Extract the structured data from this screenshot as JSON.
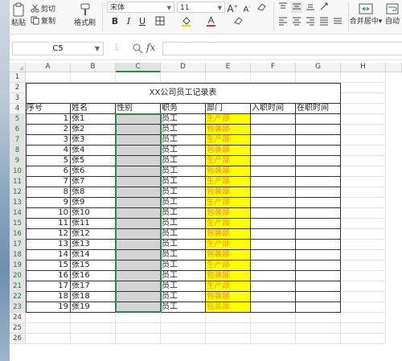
{
  "ribbon": {
    "paste_label": "粘贴",
    "cut_label": "剪切",
    "copy_label": "复制",
    "format_painter_label": "格式刷",
    "font_name": "宋体",
    "font_size": "11",
    "bold": "B",
    "italic": "I",
    "underline": "U",
    "grow_font": "A",
    "shrink_font": "A",
    "merge_center_label": "合并居中",
    "wrap_label": "自动"
  },
  "formula_bar": {
    "name_box": "C5",
    "fx": "fx",
    "formula": ""
  },
  "columns": [
    "A",
    "B",
    "C",
    "D",
    "E",
    "F",
    "G",
    "H"
  ],
  "selected_column": "C",
  "rows": [
    "1",
    "2",
    "3",
    "4",
    "5",
    "6",
    "7",
    "8",
    "9",
    "10",
    "11",
    "12",
    "13",
    "14",
    "15",
    "16",
    "17",
    "18",
    "19",
    "20",
    "21",
    "22",
    "23",
    "24",
    "25",
    "26"
  ],
  "selected_rows": [
    "5",
    "6",
    "7",
    "8",
    "9",
    "10",
    "11",
    "12",
    "13",
    "14",
    "15",
    "16",
    "17",
    "18",
    "19",
    "20",
    "21",
    "22",
    "23"
  ],
  "sheet": {
    "title": "XX公司员工记录表",
    "headers": [
      "序号",
      "姓名",
      "性别",
      "职务",
      "部门",
      "入职时间",
      "在职时间"
    ],
    "records": [
      {
        "no": "1",
        "name": "张1",
        "gender": "",
        "role": "员工",
        "dept": "生产部"
      },
      {
        "no": "2",
        "name": "张2",
        "gender": "",
        "role": "员工",
        "dept": "包装部"
      },
      {
        "no": "3",
        "name": "张3",
        "gender": "",
        "role": "员工",
        "dept": "生产部"
      },
      {
        "no": "4",
        "name": "张4",
        "gender": "",
        "role": "员工",
        "dept": "包装部"
      },
      {
        "no": "5",
        "name": "张5",
        "gender": "",
        "role": "员工",
        "dept": "生产部"
      },
      {
        "no": "6",
        "name": "张6",
        "gender": "",
        "role": "员工",
        "dept": "包装部"
      },
      {
        "no": "7",
        "name": "张7",
        "gender": "",
        "role": "员工",
        "dept": "生产部"
      },
      {
        "no": "8",
        "name": "张8",
        "gender": "",
        "role": "员工",
        "dept": "包装部"
      },
      {
        "no": "9",
        "name": "张9",
        "gender": "",
        "role": "员工",
        "dept": "生产部"
      },
      {
        "no": "10",
        "name": "张10",
        "gender": "",
        "role": "员工",
        "dept": "包装部"
      },
      {
        "no": "11",
        "name": "张11",
        "gender": "",
        "role": "员工",
        "dept": "生产部"
      },
      {
        "no": "12",
        "name": "张12",
        "gender": "",
        "role": "员工",
        "dept": "包装部"
      },
      {
        "no": "13",
        "name": "张13",
        "gender": "",
        "role": "员工",
        "dept": "生产部"
      },
      {
        "no": "14",
        "name": "张14",
        "gender": "",
        "role": "员工",
        "dept": "包装部"
      },
      {
        "no": "15",
        "name": "张15",
        "gender": "",
        "role": "员工",
        "dept": "生产部"
      },
      {
        "no": "16",
        "name": "张16",
        "gender": "",
        "role": "员工",
        "dept": "包装部"
      },
      {
        "no": "17",
        "name": "张17",
        "gender": "",
        "role": "员工",
        "dept": "生产部"
      },
      {
        "no": "18",
        "name": "张18",
        "gender": "",
        "role": "员工",
        "dept": "包装部"
      },
      {
        "no": "19",
        "name": "张19",
        "gender": "",
        "role": "员工",
        "dept": "包装部"
      }
    ]
  },
  "colors": {
    "selection": "#2a8a4e",
    "dept_fill": "#ffff00",
    "dept_text": "#ff8c1a",
    "gender_fill": "#d4d4d4"
  }
}
